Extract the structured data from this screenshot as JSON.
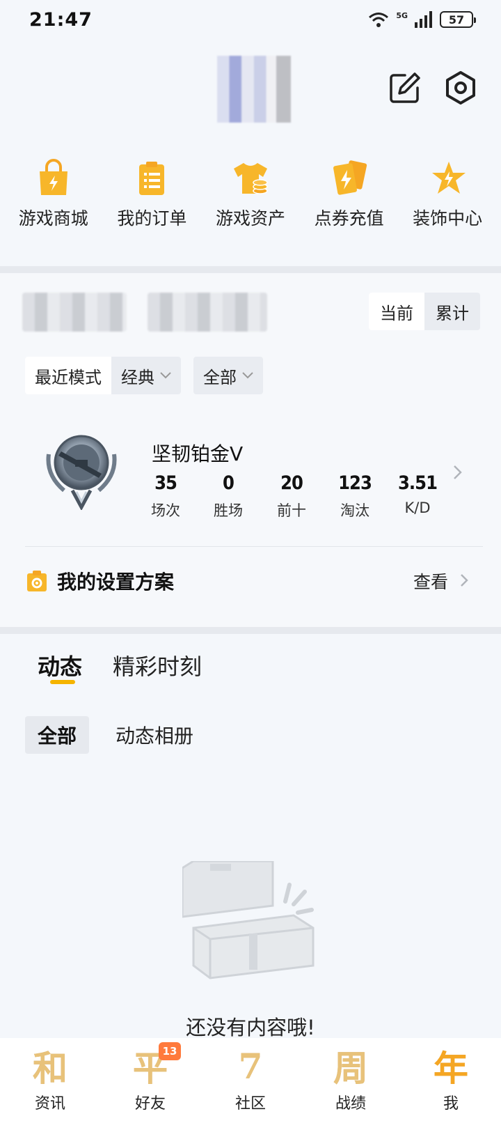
{
  "status_bar": {
    "time": "21:47",
    "network": "5G",
    "battery": "57"
  },
  "shortcuts": [
    {
      "label": "游戏商城",
      "icon": "shopping-bag-icon"
    },
    {
      "label": "我的订单",
      "icon": "clipboard-icon"
    },
    {
      "label": "游戏资产",
      "icon": "tshirt-coins-icon"
    },
    {
      "label": "点券充值",
      "icon": "cards-icon"
    },
    {
      "label": "装饰中心",
      "icon": "star-icon"
    }
  ],
  "stats": {
    "toggle": {
      "current": "当前",
      "cumulative": "累计"
    },
    "filters": {
      "recent_mode": "最近模式",
      "mode": "经典",
      "scope": "全部"
    },
    "rank": {
      "name": "坚韧铂金V",
      "items": [
        {
          "value": "35",
          "label": "场次"
        },
        {
          "value": "0",
          "label": "胜场"
        },
        {
          "value": "20",
          "label": "前十"
        },
        {
          "value": "123",
          "label": "淘汰"
        },
        {
          "value": "3.51",
          "label": "K/D"
        }
      ]
    },
    "settings": {
      "title": "我的设置方案",
      "view": "查看"
    }
  },
  "feed": {
    "tabs": [
      "动态",
      "精彩时刻"
    ],
    "sub_tabs": [
      "全部",
      "动态相册"
    ],
    "empty_text": "还没有内容哦!"
  },
  "bottom_nav": [
    {
      "glyph": "和",
      "label": "资讯"
    },
    {
      "glyph": "平",
      "label": "好友",
      "badge": "13"
    },
    {
      "glyph": "7",
      "label": "社区"
    },
    {
      "glyph": "周",
      "label": "战绩"
    },
    {
      "glyph": "年",
      "label": "我"
    }
  ],
  "colors": {
    "accent": "#f5b400",
    "background": "#f4f7fb",
    "badge": "#ff7a3c"
  }
}
